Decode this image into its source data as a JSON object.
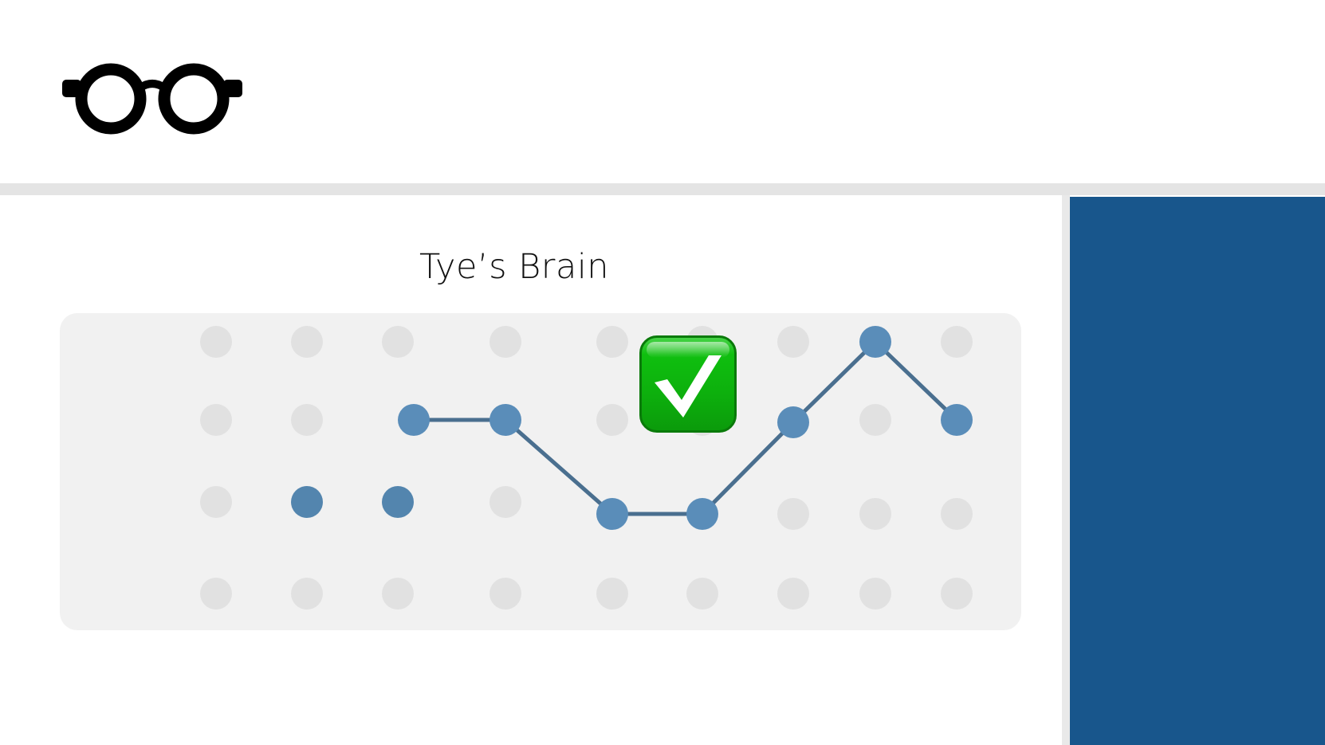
{
  "header": {
    "logo_icon": "glasses-icon"
  },
  "board": {
    "title": "Tye’s Brain",
    "status_icon": "check-mark-button-icon",
    "colors": {
      "empty_dot": "#e1e1e1",
      "path_dot": "#5a8db9",
      "alt_dot": "#5385ae",
      "path_line": "#4a6f8f",
      "board_bg": "#f1f1f1",
      "side_panel": "#18568c"
    },
    "columns": 9,
    "rows": 4,
    "path_segment_1": [
      [
        2,
        1
      ],
      [
        3,
        1
      ]
    ],
    "path_segment_2": [
      [
        3,
        1
      ],
      [
        4,
        2
      ],
      [
        5,
        2
      ],
      [
        6,
        1
      ],
      [
        7,
        0
      ],
      [
        8,
        1
      ]
    ],
    "extra_filled": [
      [
        1,
        2
      ],
      [
        2,
        2
      ]
    ]
  }
}
